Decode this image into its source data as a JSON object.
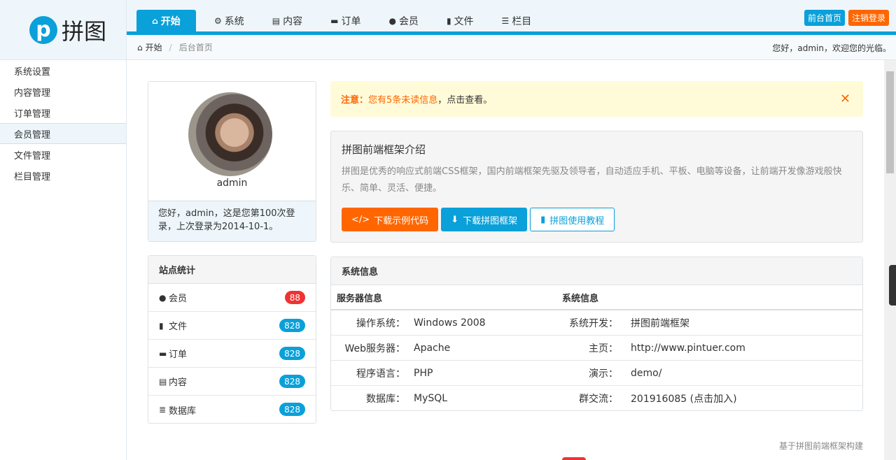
{
  "logo": {
    "glyph": "p",
    "text": "拼图"
  },
  "nav": {
    "items": [
      {
        "icon": "home-icon",
        "label": "开始"
      },
      {
        "icon": "gear-icon",
        "label": "系统"
      },
      {
        "icon": "file-icon",
        "label": "内容"
      },
      {
        "icon": "cart-icon",
        "label": "订单"
      },
      {
        "icon": "user-icon",
        "label": "会员"
      },
      {
        "icon": "file-icon",
        "label": "文件"
      },
      {
        "icon": "list-icon",
        "label": "栏目"
      }
    ]
  },
  "top_buttons": {
    "home": "前台首页",
    "logout": "注销登录"
  },
  "breadcrumb": {
    "start": "开始",
    "current": "后台首页",
    "welcome": "您好，admin，欢迎您的光临。"
  },
  "sidebar": {
    "items": [
      {
        "label": "系统设置"
      },
      {
        "label": "内容管理"
      },
      {
        "label": "订单管理"
      },
      {
        "label": "会员管理"
      },
      {
        "label": "文件管理"
      },
      {
        "label": "栏目管理"
      }
    ]
  },
  "profile": {
    "name": "admin",
    "login_msg": "您好，admin，这是您第100次登录，上次登录为2014-10-1。"
  },
  "stats": {
    "title": "站点统计",
    "rows": [
      {
        "icon": "user-icon",
        "label": "会员",
        "count": "88",
        "color": "#e33"
      },
      {
        "icon": "file-icon",
        "label": "文件",
        "count": "828",
        "color": "#0aa0d9"
      },
      {
        "icon": "cart-icon",
        "label": "订单",
        "count": "828",
        "color": "#0aa0d9"
      },
      {
        "icon": "file-text-icon",
        "label": "内容",
        "count": "828",
        "color": "#0aa0d9"
      },
      {
        "icon": "database-icon",
        "label": "数据库",
        "count": "828",
        "color": "#0aa0d9"
      }
    ]
  },
  "notice": {
    "bold": "注意：",
    "text": "您有5条未读信息",
    "link": "，点击查看。"
  },
  "intro": {
    "title": "拼图前端框架介绍",
    "text": "拼图是优秀的响应式前端CSS框架，国内前端框架先驱及领导者，自动适应手机、平板、电脑等设备，让前端开发像游戏般快乐、简单、灵活、便捷。",
    "btn_code": "下载示例代码",
    "btn_download": "下载拼图框架",
    "btn_docs": "拼图使用教程"
  },
  "sysinfo": {
    "title": "系统信息",
    "head_left": "服务器信息",
    "head_right": "系统信息",
    "rows": [
      {
        "k1": "操作系统：",
        "v1": "Windows 2008",
        "k2": "系统开发：",
        "v2": "拼图前端框架"
      },
      {
        "k1": "Web服务器：",
        "v1": "Apache",
        "k2": "主页：",
        "v2": "http://www.pintuer.com"
      },
      {
        "k1": "程序语言：",
        "v1": "PHP",
        "k2": "演示：",
        "v2": "demo/"
      },
      {
        "k1": "数据库：",
        "v1": "MySQL",
        "k2": "群交流：",
        "v2": "201916085 (点击加入)"
      }
    ]
  },
  "footer": {
    "text": "基于拼图前端框架构建"
  },
  "colors": {
    "accent": "#0aa0d9",
    "warning": "#ff6600",
    "danger": "#ee3333"
  }
}
